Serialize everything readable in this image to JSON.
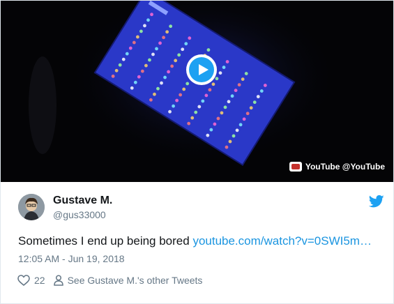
{
  "video": {
    "play_label": "Play video",
    "source_label": "YouTube @YouTube",
    "icons": [
      "play-icon",
      "youtube-icon"
    ]
  },
  "tweet": {
    "author_name": "Gustave M.",
    "author_handle": "@gus33000",
    "text_prefix": "Sometimes I end up being bored ",
    "link_text": "youtube.com/watch?v=0SWI5m…",
    "timestamp": "12:05 AM - Jun 19, 2018",
    "like_count": "22",
    "profile_link": "See Gustave M.'s other Tweets",
    "icons": [
      "twitter-bird-icon",
      "heart-icon",
      "person-icon"
    ]
  },
  "colors": {
    "accent": "#1da1f2",
    "link": "#1b95e0",
    "muted": "#657786",
    "text": "#14171a",
    "screen_blue": "#2a38c8"
  }
}
